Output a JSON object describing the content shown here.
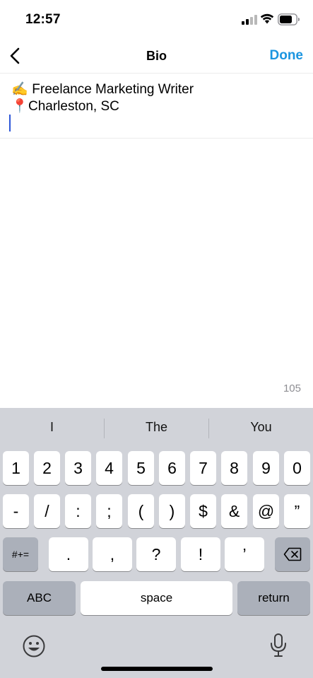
{
  "status": {
    "time": "12:57"
  },
  "nav": {
    "title": "Bio",
    "done_label": "Done"
  },
  "bio": {
    "line1_emoji": "✍️",
    "line1_text": "Freelance Marketing Writer",
    "line2_emoji": "📍",
    "line2_text": "Charleston, SC"
  },
  "char_count": "105",
  "keyboard": {
    "suggestions": [
      "I",
      "The",
      "You"
    ],
    "row1": [
      "1",
      "2",
      "3",
      "4",
      "5",
      "6",
      "7",
      "8",
      "9",
      "0"
    ],
    "row2": [
      "-",
      "/",
      ":",
      ";",
      "(",
      ")",
      "$",
      "&",
      "@",
      "”"
    ],
    "row3_left": "#+=",
    "row3": [
      ".",
      ",",
      "?",
      "!",
      "’"
    ],
    "abc_label": "ABC",
    "space_label": "space",
    "return_label": "return"
  },
  "icons": {
    "back": "chevron-left-icon",
    "signal": "cellular-signal-icon",
    "wifi": "wifi-icon",
    "battery": "battery-icon",
    "delete": "backspace-icon",
    "emoji": "emoji-face-icon",
    "mic": "microphone-icon"
  },
  "colors": {
    "accent": "#1b95e0",
    "cursor": "#2d56d8",
    "keyboard_bg": "#d1d3d9",
    "key_dark": "#abb0ba"
  }
}
